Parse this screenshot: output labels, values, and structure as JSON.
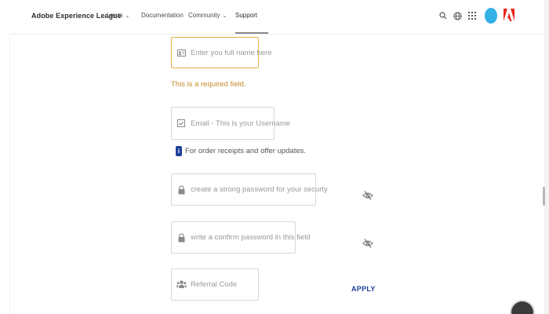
{
  "header": {
    "brand": "Adobe Experience League",
    "nav": [
      {
        "label": "Learn",
        "has_dropdown": true
      },
      {
        "label": "Documentation",
        "has_dropdown": false
      },
      {
        "label": "Community",
        "has_dropdown": true
      },
      {
        "label": "Support",
        "has_dropdown": false,
        "active": true
      }
    ],
    "icons": [
      "search-icon",
      "globe-icon",
      "apps-grid-icon"
    ],
    "dropdown_glyph": "⌄"
  },
  "form": {
    "full_name": {
      "placeholder": "Enter you full name here",
      "icon": "id-card-icon"
    },
    "full_name_error": "This is a required field.",
    "email": {
      "placeholder": "Email - This is your Username",
      "icon": "mail-icon"
    },
    "email_info": {
      "badge": "i",
      "text": "For order receipts and offer updates."
    },
    "password": {
      "placeholder": "create a strong password for your securty",
      "icon": "lock-icon"
    },
    "confirm_password": {
      "placeholder": "write a confirm password in this field",
      "icon": "lock-icon"
    },
    "referral": {
      "placeholder": "Referral Code",
      "icon": "users-icon"
    },
    "apply_label": "APPLY"
  },
  "colors": {
    "accent": "#1d3f99",
    "error": "#c48a2a",
    "error_border": "#e2b347",
    "avatar": "#33b0e6",
    "adobe_red": "#e8281e"
  }
}
